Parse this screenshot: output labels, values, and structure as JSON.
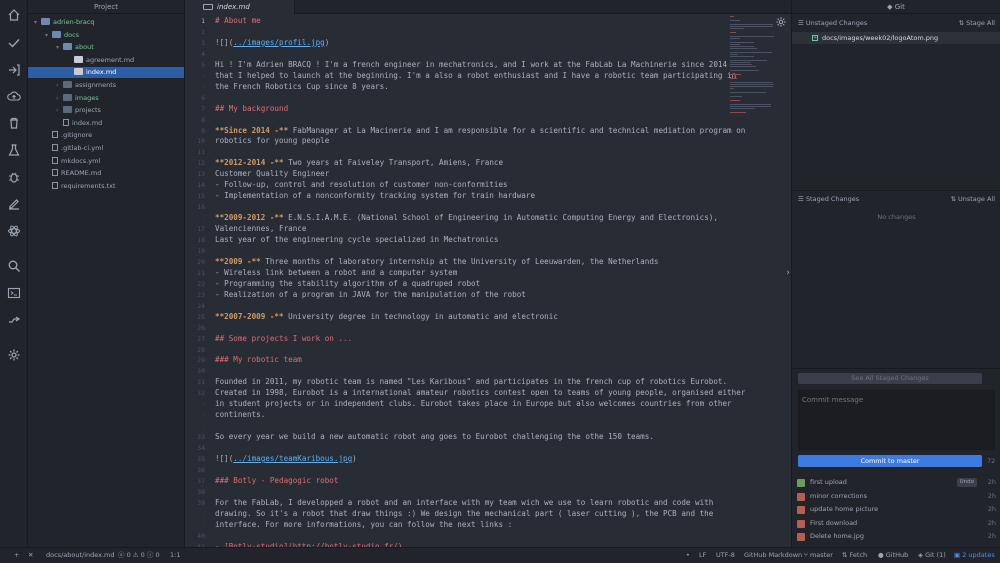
{
  "tree": {
    "title": "Project",
    "rows": [
      {
        "label": "adrien-bracq",
        "type": "folder-open",
        "depth": 0
      },
      {
        "label": "docs",
        "type": "folder-open",
        "depth": 1
      },
      {
        "label": "about",
        "type": "folder-open",
        "depth": 2
      },
      {
        "label": "agreement.md",
        "type": "md",
        "depth": 3
      },
      {
        "label": "index.md",
        "type": "md",
        "depth": 3,
        "selected": true
      },
      {
        "label": "assignments",
        "type": "folder",
        "depth": 2
      },
      {
        "label": "images",
        "type": "folder",
        "depth": 2,
        "modified": true
      },
      {
        "label": "projects",
        "type": "folder",
        "depth": 2
      },
      {
        "label": "index.md",
        "type": "file",
        "depth": 2
      },
      {
        "label": ".gitignore",
        "type": "file",
        "depth": 1
      },
      {
        "label": ".gitlab-ci.yml",
        "type": "file",
        "depth": 1
      },
      {
        "label": "mkdocs.yml",
        "type": "file",
        "depth": 1
      },
      {
        "label": "README.md",
        "type": "file",
        "depth": 1
      },
      {
        "label": "requirements.txt",
        "type": "file",
        "depth": 1
      }
    ]
  },
  "tab": {
    "label": "index.md"
  },
  "editor": {
    "gutter": [
      "1",
      "2",
      "3",
      "4",
      "5",
      "·",
      "·",
      "6",
      "7",
      "8",
      "9",
      "10",
      "11",
      "12",
      "13",
      "14",
      "15",
      "16",
      "·",
      "17",
      "18",
      "19",
      "20",
      "21",
      "22",
      "23",
      "24",
      "25",
      "26",
      "27",
      "28",
      "29",
      "30",
      "31",
      "32",
      "·",
      "·",
      "·",
      "33",
      "34",
      "35",
      "36",
      "37",
      "38",
      "39",
      "·",
      "·",
      "40",
      "41"
    ],
    "lines": [
      [
        {
          "t": "# About me",
          "c": "h"
        }
      ],
      [],
      [
        {
          "t": "![](",
          "c": ""
        },
        {
          "t": "../images/profil.jpg",
          "c": "lnk"
        },
        {
          "t": ")",
          "c": ""
        }
      ],
      [],
      [
        {
          "t": "Hi ! I'm Adrien BRACQ ! I'm a french engineer in mechatronics, and I work at the FabLab La Machinerie since 2014",
          "c": ""
        }
      ],
      [
        {
          "t": "that I helped to launch at the beginning. I'm a also a robot enthusiast and I have a robotic team participating in",
          "c": ""
        }
      ],
      [
        {
          "t": "the French Robotics Cup since 8 years.",
          "c": ""
        }
      ],
      [],
      [
        {
          "t": "## My background",
          "c": "h"
        }
      ],
      [],
      [
        {
          "t": "**Since 2014 -** ",
          "c": "b"
        },
        {
          "t": "FabManager at La Macinerie and I am responsible for a scientific and technical mediation program on",
          "c": ""
        }
      ],
      [
        {
          "t": "robotics for young people",
          "c": ""
        }
      ],
      [],
      [
        {
          "t": "**2012-2014 -** ",
          "c": "b"
        },
        {
          "t": "Two years at Faiveley Transport, Amiens, France",
          "c": ""
        }
      ],
      [
        {
          "t": "Customer Quality Engineer",
          "c": ""
        }
      ],
      [
        {
          "t": "- Follow-up, control and resolution of customer non-conformities",
          "c": ""
        }
      ],
      [
        {
          "t": "- Implementation of a nonconformity tracking system for train hardware",
          "c": ""
        }
      ],
      [],
      [
        {
          "t": "**2009-2012 -** ",
          "c": "b"
        },
        {
          "t": "E.N.S.I.A.M.E. (National School of Engineering in Automatic Computing Energy and Electronics),",
          "c": ""
        }
      ],
      [
        {
          "t": "Valenciennes, France",
          "c": ""
        }
      ],
      [
        {
          "t": "Last year of the engineering cycle specialized in Mechatronics",
          "c": ""
        }
      ],
      [],
      [
        {
          "t": "**2009 -** ",
          "c": "b"
        },
        {
          "t": "Three months of laboratory internship at the University of Leeuwarden, the Netherlands",
          "c": ""
        }
      ],
      [
        {
          "t": "- Wireless link between a robot and a computer system",
          "c": ""
        }
      ],
      [
        {
          "t": "- Programming the stability algorithm of a quadruped robot",
          "c": ""
        }
      ],
      [
        {
          "t": "- Realization of a program in JAVA for the manipulation of the robot",
          "c": ""
        }
      ],
      [],
      [
        {
          "t": "**2007-2009 -** ",
          "c": "b"
        },
        {
          "t": "University degree in technology in automatic and electronic",
          "c": ""
        }
      ],
      [],
      [
        {
          "t": "## Some projects I work on ...",
          "c": "h"
        }
      ],
      [],
      [
        {
          "t": "### My robotic team",
          "c": "h"
        }
      ],
      [],
      [
        {
          "t": "Founded in 2011, my robotic team is named \"Les Karibous\" and participates in the french cup of robotics Eurobot.",
          "c": ""
        }
      ],
      [
        {
          "t": "Created in 1998, Eurobot is a international amateur robotics contest open to teams of young people, organised either",
          "c": ""
        }
      ],
      [
        {
          "t": "in student projects or in independent clubs. Eurobot takes place in Europe but also welcomes countries from other",
          "c": ""
        }
      ],
      [
        {
          "t": "continents.",
          "c": ""
        }
      ],
      [],
      [
        {
          "t": "So every year we build a new automatic robot ang goes to Eurobot challenging the othe 150 teams.",
          "c": ""
        }
      ],
      [],
      [
        {
          "t": "![](",
          "c": ""
        },
        {
          "t": "../images/teamKaribous.jpg",
          "c": "lnk"
        },
        {
          "t": ")",
          "c": ""
        }
      ],
      [],
      [
        {
          "t": "### Botly - Pedagogic robot",
          "c": "h"
        }
      ],
      [],
      [
        {
          "t": "For the FabLab, I developped a robot and an interface with my team wich we use to learn robotic and code with",
          "c": ""
        }
      ],
      [
        {
          "t": "drawing. So it's a robot that draw things :) We design the mechanical part ( laser cutting ), the PCB and the",
          "c": ""
        }
      ],
      [
        {
          "t": "interface. For more informations, you can follow the next links :",
          "c": ""
        }
      ],
      [],
      [
        {
          "t": "- [Botly-studio](http://botly-studio.fr/)",
          "c": "h"
        }
      ]
    ]
  },
  "git": {
    "title": "Git",
    "unstaged_title": "Unstaged Changes",
    "stage_all": "Stage All",
    "unstaged_file": "docs/images/week02/logoAtom.png",
    "staged_title": "Staged Changes",
    "unstage_all": "Unstage All",
    "no_changes": "No changes",
    "see_all": "See All Staged Changes",
    "commit_placeholder": "Commit message",
    "commit_button": "Commit to master",
    "char_count": "72",
    "commits": [
      {
        "message": "first upload",
        "ago": "2h",
        "undo": "Undo",
        "avatar": "green"
      },
      {
        "message": "minor corrections",
        "ago": "2h",
        "avatar": "red"
      },
      {
        "message": "update home picture",
        "ago": "2h",
        "avatar": "red"
      },
      {
        "message": "First download",
        "ago": "2h",
        "avatar": "red"
      },
      {
        "message": "Delete home.jpg",
        "ago": "2h",
        "avatar": "red"
      }
    ]
  },
  "status": {
    "path": "docs/about/index.md",
    "diagnostics": "0 ⚠ 0 ⓘ 0",
    "cursor": "1:1",
    "line_ending": "LF",
    "encoding": "UTF-8",
    "grammar": "GitHub Markdown",
    "branch": "master",
    "fetch": "Fetch",
    "github": "GitHub",
    "git": "Git (1)",
    "updates": "2 updates"
  }
}
